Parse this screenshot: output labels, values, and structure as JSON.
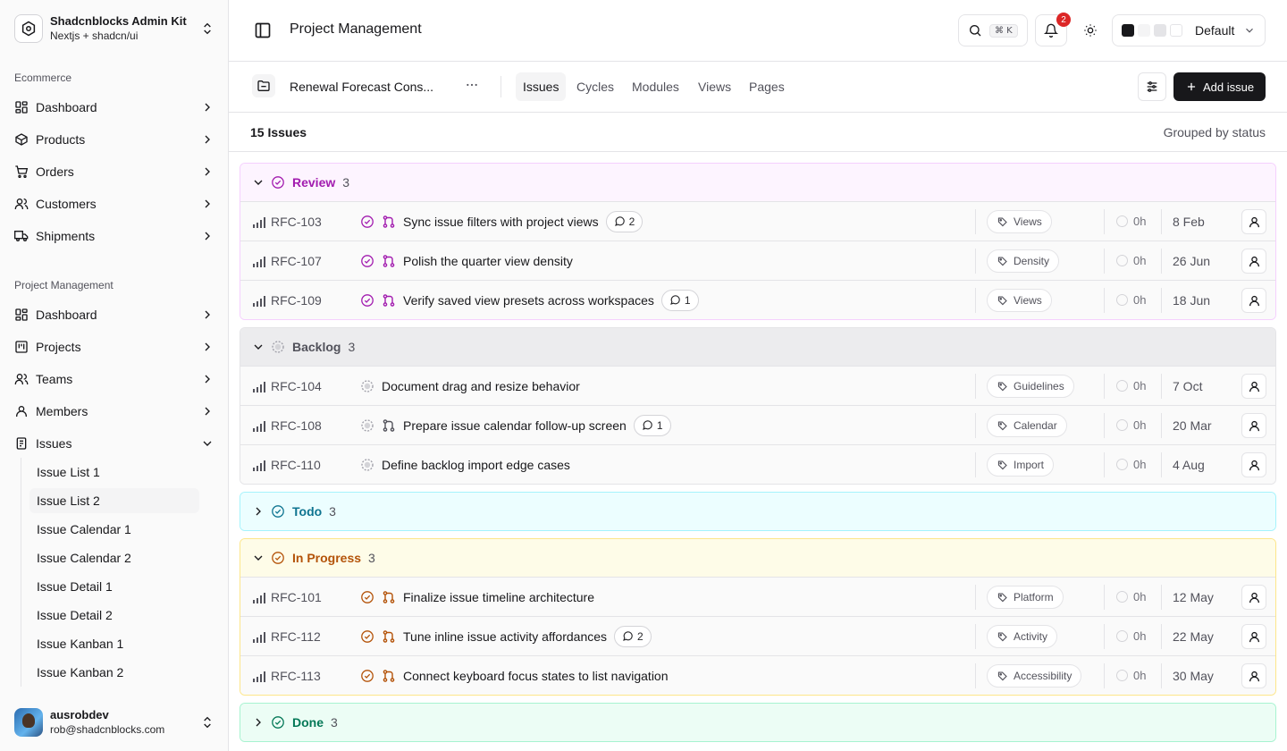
{
  "sidebar": {
    "brand": {
      "title": "Shadcnblocks Admin Kit",
      "subtitle": "Nextjs + shadcn/ui"
    },
    "sections": [
      {
        "label": "Ecommerce",
        "items": [
          {
            "label": "Dashboard",
            "icon": "dashboard-icon"
          },
          {
            "label": "Products",
            "icon": "box-icon"
          },
          {
            "label": "Orders",
            "icon": "cart-icon"
          },
          {
            "label": "Customers",
            "icon": "users-icon"
          },
          {
            "label": "Shipments",
            "icon": "truck-icon"
          }
        ]
      },
      {
        "label": "Project Management",
        "items": [
          {
            "label": "Dashboard",
            "icon": "dashboard-icon"
          },
          {
            "label": "Projects",
            "icon": "kanban-icon"
          },
          {
            "label": "Teams",
            "icon": "users-icon"
          },
          {
            "label": "Members",
            "icon": "user-icon"
          },
          {
            "label": "Issues",
            "icon": "clipboard-icon"
          }
        ]
      }
    ],
    "issues_sub": [
      "Issue List 1",
      "Issue List 2",
      "Issue Calendar 1",
      "Issue Calendar 2",
      "Issue Detail 1",
      "Issue Detail 2",
      "Issue Kanban 1",
      "Issue Kanban 2"
    ],
    "issues_sub_active": 1,
    "user": {
      "name": "ausrobdev",
      "email": "rob@shadcnblocks.com"
    }
  },
  "header": {
    "title": "Project Management",
    "kbd": "⌘ K",
    "notifications": "2",
    "theme": "Default",
    "swatches": [
      "#18181b",
      "#f4f4f5",
      "#e4e4e7",
      "#ffffff"
    ]
  },
  "subheader": {
    "project": "Renewal Forecast Cons...",
    "tabs": [
      "Issues",
      "Cycles",
      "Modules",
      "Views",
      "Pages"
    ],
    "active_tab": 0,
    "add_label": "Add issue"
  },
  "summary": {
    "count": "15 Issues",
    "grouped": "Grouped by status"
  },
  "groups": [
    {
      "name": "Review",
      "count": "3",
      "expanded": true,
      "color": "#a21caf",
      "bg": "#fdf4ff",
      "border": "#f5d0fe",
      "statusIcon": "check-circle",
      "issues": [
        {
          "id": "RFC-103",
          "title": "Sync issue filters with project views",
          "comments": "2",
          "label": "Views",
          "est": "0h",
          "date": "8 Feb",
          "branch": true
        },
        {
          "id": "RFC-107",
          "title": "Polish the quarter view density",
          "comments": "",
          "label": "Density",
          "est": "0h",
          "date": "26 Jun",
          "branch": true
        },
        {
          "id": "RFC-109",
          "title": "Verify saved view presets across workspaces",
          "comments": "1",
          "label": "Views",
          "est": "0h",
          "date": "18 Jun",
          "branch": true
        }
      ]
    },
    {
      "name": "Backlog",
      "count": "3",
      "expanded": true,
      "color": "#52525b",
      "bg": "#ececee",
      "border": "#e4e4e7",
      "statusIcon": "dotted-circle",
      "issues": [
        {
          "id": "RFC-104",
          "title": "Document drag and resize behavior",
          "comments": "",
          "label": "Guidelines",
          "est": "0h",
          "date": "7 Oct",
          "branch": false
        },
        {
          "id": "RFC-108",
          "title": "Prepare issue calendar follow-up screen",
          "comments": "1",
          "label": "Calendar",
          "est": "0h",
          "date": "20 Mar",
          "branch": true
        },
        {
          "id": "RFC-110",
          "title": "Define backlog import edge cases",
          "comments": "",
          "label": "Import",
          "est": "0h",
          "date": "4 Aug",
          "branch": false
        }
      ]
    },
    {
      "name": "Todo",
      "count": "3",
      "expanded": false,
      "color": "#0e7490",
      "bg": "#ecfeff",
      "border": "#a5f3fc",
      "statusIcon": "check-circle",
      "issues": []
    },
    {
      "name": "In Progress",
      "count": "3",
      "expanded": true,
      "color": "#b45309",
      "bg": "#fefce8",
      "border": "#fde68a",
      "statusIcon": "check-circle",
      "issues": [
        {
          "id": "RFC-101",
          "title": "Finalize issue timeline architecture",
          "comments": "",
          "label": "Platform",
          "est": "0h",
          "date": "12 May",
          "branch": true
        },
        {
          "id": "RFC-112",
          "title": "Tune inline issue activity affordances",
          "comments": "2",
          "label": "Activity",
          "est": "0h",
          "date": "22 May",
          "branch": true
        },
        {
          "id": "RFC-113",
          "title": "Connect keyboard focus states to list navigation",
          "comments": "",
          "label": "Accessibility",
          "est": "0h",
          "date": "30 May",
          "branch": true
        }
      ]
    },
    {
      "name": "Done",
      "count": "3",
      "expanded": false,
      "color": "#047857",
      "bg": "#ecfdf5",
      "border": "#a7f3d0",
      "statusIcon": "check-circle",
      "issues": []
    }
  ]
}
